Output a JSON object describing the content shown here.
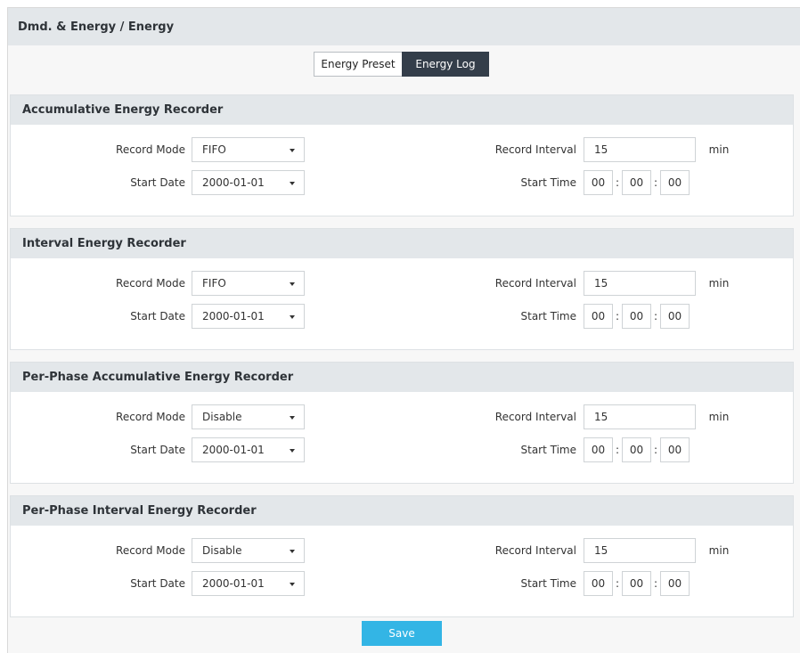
{
  "header": {
    "title": "Dmd. & Energy / Energy"
  },
  "tabs": [
    {
      "label": "Energy Preset",
      "active": false
    },
    {
      "label": "Energy Log",
      "active": true
    }
  ],
  "labels": {
    "record_mode": "Record Mode",
    "start_date": "Start Date",
    "record_interval": "Record Interval",
    "start_time": "Start Time",
    "unit_min": "min",
    "time_sep": ":"
  },
  "sections": [
    {
      "title": "Accumulative Energy Recorder",
      "record_mode": "FIFO",
      "start_date": "2000-01-01",
      "record_interval": "15",
      "start_time": {
        "hh": "00",
        "mm": "00",
        "ss": "00"
      }
    },
    {
      "title": "Interval Energy Recorder",
      "record_mode": "FIFO",
      "start_date": "2000-01-01",
      "record_interval": "15",
      "start_time": {
        "hh": "00",
        "mm": "00",
        "ss": "00"
      }
    },
    {
      "title": "Per-Phase Accumulative Energy Recorder",
      "record_mode": "Disable",
      "start_date": "2000-01-01",
      "record_interval": "15",
      "start_time": {
        "hh": "00",
        "mm": "00",
        "ss": "00"
      }
    },
    {
      "title": "Per-Phase Interval Energy Recorder",
      "record_mode": "Disable",
      "start_date": "2000-01-01",
      "record_interval": "15",
      "start_time": {
        "hh": "00",
        "mm": "00",
        "ss": "00"
      }
    }
  ],
  "save_label": "Save",
  "colors": {
    "header_bg": "#e3e7ea",
    "active_tab": "#343e4a",
    "save_button": "#33b5e5"
  }
}
